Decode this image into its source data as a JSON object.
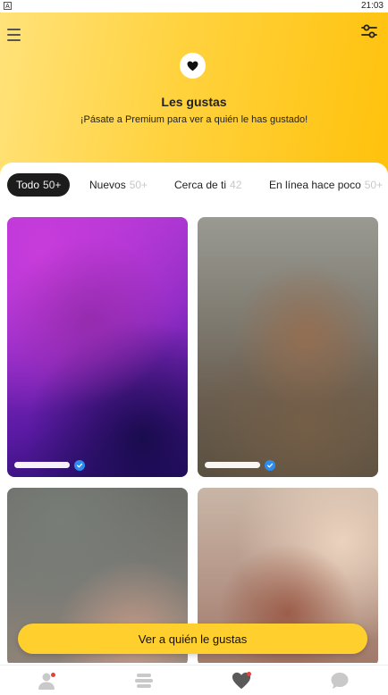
{
  "status_bar": {
    "app_glyph": "A",
    "time": "21:03"
  },
  "header": {
    "title": "Les gustas",
    "subtitle": "¡Pásate a Premium para ver a quién le has gustado!",
    "menu_icon": "hamburger-menu-icon",
    "filter_icon": "filter-sliders-icon",
    "badge_icon": "heart-icon"
  },
  "tabs": [
    {
      "label": "Todo",
      "count": "50+",
      "active": true
    },
    {
      "label": "Nuevos",
      "count": "50+",
      "active": false
    },
    {
      "label": "Cerca de ti",
      "count": "42",
      "active": false
    },
    {
      "label": "En línea hace poco",
      "count": "50+",
      "active": false
    }
  ],
  "cards": [
    {
      "blurred": true,
      "verified": true
    },
    {
      "blurred": true,
      "verified": true
    },
    {
      "blurred": true,
      "verified": false
    },
    {
      "blurred": true,
      "verified": false
    }
  ],
  "cta": {
    "label": "Ver a quién le gustas"
  },
  "bottom_nav": [
    {
      "icon": "profile-icon",
      "notification": true
    },
    {
      "icon": "discover-stack-icon",
      "notification": false
    },
    {
      "icon": "likes-heart-icon",
      "notification": true,
      "active": true
    },
    {
      "icon": "chat-bubble-icon",
      "notification": false
    }
  ],
  "colors": {
    "accent": "#ffc20c",
    "cta": "#ffcf2e",
    "active_tab": "#1c1c1c",
    "verified": "#2d8cf0",
    "notification_dot": "#e4433b"
  }
}
